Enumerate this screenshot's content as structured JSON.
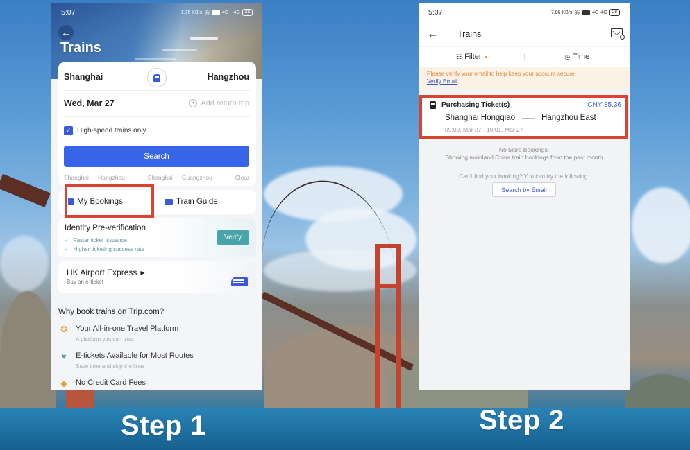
{
  "steps": [
    {
      "label": "Step 1"
    },
    {
      "label": "Step 2"
    }
  ],
  "step1": {
    "status_bar": {
      "time": "5:07",
      "net_speed": "1.75 KB/s",
      "signal_1": "4G+",
      "signal_2": "4G",
      "battery": "28"
    },
    "header": {
      "title": "Trains"
    },
    "search": {
      "from_city": "Shanghai",
      "to_city": "Hangzhou",
      "date": "Wed, Mar 27",
      "add_return_label": "Add return trip",
      "high_speed_label": "High-speed trains only",
      "high_speed_checked": true,
      "search_button": "Search",
      "history": [
        "Shanghai — Hangzhou",
        "Shanghai — Guangzhou"
      ],
      "clear_label": "Clear"
    },
    "quick_links": {
      "my_bookings": "My Bookings",
      "train_guide": "Train Guide"
    },
    "verification": {
      "title": "Identity Pre-verification",
      "bullets": [
        "Faster ticket issuance",
        "Higher ticketing success rate"
      ],
      "button": "Verify"
    },
    "hk_express": {
      "title": "HK Airport Express",
      "subtitle": "Buy an e-ticket"
    },
    "why": {
      "title": "Why book trains on Trip.com?",
      "items": [
        {
          "icon": "laurel-star-icon",
          "title": "Your All-in-one Travel Platform",
          "subtitle": "A platform you can trust"
        },
        {
          "icon": "heart-check-icon",
          "title": "E-tickets Available for Most Routes",
          "subtitle": "Save time and skip the lines"
        },
        {
          "icon": "tag-icon",
          "title": "No Credit Card Fees",
          "subtitle": ""
        }
      ]
    }
  },
  "step2": {
    "status_bar": {
      "time": "5:07",
      "net_speed": "7.86 KB/s",
      "signal_1": "4G",
      "signal_2": "4G",
      "battery": "28"
    },
    "nav": {
      "title": "Trains"
    },
    "filters": {
      "filter_label": "Filter",
      "time_label": "Time"
    },
    "notice": {
      "text": "Please verify your email to help keep your account secure",
      "link": "Verify Email"
    },
    "ticket": {
      "status": "Purchasing Ticket(s)",
      "price": "CNY 85.36",
      "from_station": "Shanghai Hongqiao",
      "to_station": "Hangzhou East",
      "time_range": "09:09, Mar 27 - 10:01, Mar 27"
    },
    "empty": {
      "line1": "No More Bookings.",
      "line2": "Showing mainland China train bookings from the past month",
      "help": "Can't find your booking? You can try the following:",
      "button": "Search by Email"
    }
  },
  "colors": {
    "highlight": "#d9432f",
    "primary": "#3864e8",
    "verify": "#48a4a8",
    "price": "#3b62c9",
    "notice_text": "#e0893c"
  }
}
